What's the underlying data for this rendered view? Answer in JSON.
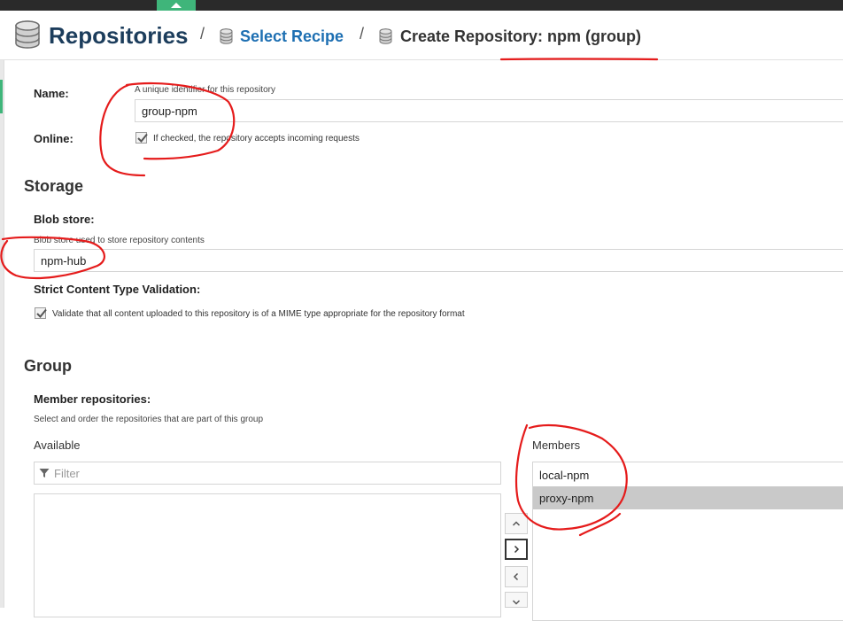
{
  "header": {
    "breadcrumb_root": "Repositories",
    "separator": "/",
    "breadcrumb_link": "Select Recipe",
    "breadcrumb_current": "Create Repository: npm (group)"
  },
  "form": {
    "name_label": "Name:",
    "name_help": "A unique identifier for this repository",
    "name_value": "group-npm",
    "online_label": "Online:",
    "online_checked": true,
    "online_help": "If checked, the repository accepts incoming requests"
  },
  "storage": {
    "title": "Storage",
    "blob_label": "Blob store:",
    "blob_help": "Blob store used to store repository contents",
    "blob_value": "npm-hub",
    "strict_label": "Strict Content Type Validation:",
    "strict_checked": true,
    "strict_help": "Validate that all content uploaded to this repository is of a MIME type appropriate for the repository format"
  },
  "group": {
    "title": "Group",
    "member_label": "Member repositories:",
    "member_help": "Select and order the repositories that are part of this group",
    "available_title": "Available",
    "filter_placeholder": "Filter",
    "members_title": "Members",
    "members": [
      {
        "name": "local-npm",
        "selected": false
      },
      {
        "name": "proxy-npm",
        "selected": true
      }
    ]
  },
  "colors": {
    "brand_green": "#3fb57a",
    "link_blue": "#1d6fb2",
    "title_navy": "#1c3d5c",
    "annotation_red": "#e51b1b"
  },
  "icons": [
    "database-icon",
    "check-icon",
    "filter-icon",
    "chevron-up-icon",
    "chevron-right-icon",
    "chevron-left-icon",
    "chevron-down-icon"
  ]
}
